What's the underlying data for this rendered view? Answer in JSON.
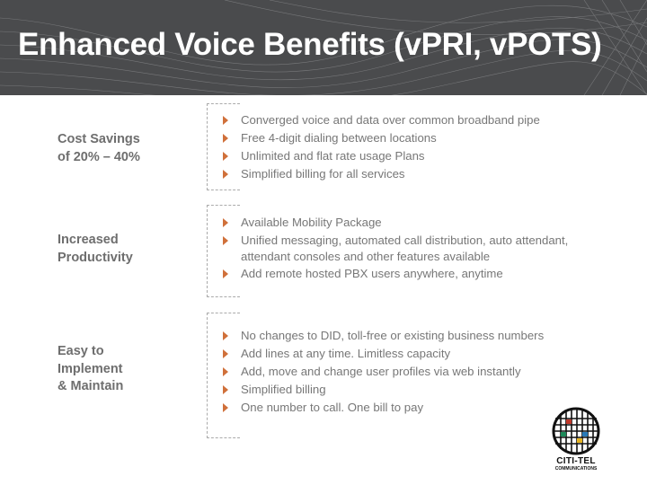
{
  "header": {
    "title": "Enhanced Voice Benefits (vPRI, vPOTS)"
  },
  "sections": [
    {
      "label": [
        "Cost Savings",
        "of 20% – 40%"
      ],
      "bullets": [
        "Converged voice and data over common broadband pipe",
        "Free 4-digit dialing between locations",
        "Unlimited and flat rate usage Plans",
        "Simplified billing for all services"
      ]
    },
    {
      "label": [
        "Increased",
        "Productivity"
      ],
      "bullets": [
        "Available Mobility Package",
        "Unified messaging, automated call distribution, auto attendant, attendant consoles and other features available",
        "Add remote hosted PBX users anywhere, anytime"
      ]
    },
    {
      "label": [
        "Easy to",
        "Implement",
        "& Maintain"
      ],
      "bullets": [
        "No changes to DID, toll-free or existing business numbers",
        "Add lines at any time. Limitless capacity",
        "Add, move and change user profiles via web instantly",
        "Simplified billing",
        "One number to call. One bill to pay"
      ]
    }
  ],
  "logo": {
    "name": "CITI-TEL",
    "subtitle": "COMMUNICATIONS"
  },
  "colors": {
    "header_bg": "#4a4b4d",
    "bullet": "#d0703a",
    "text": "#777777"
  }
}
